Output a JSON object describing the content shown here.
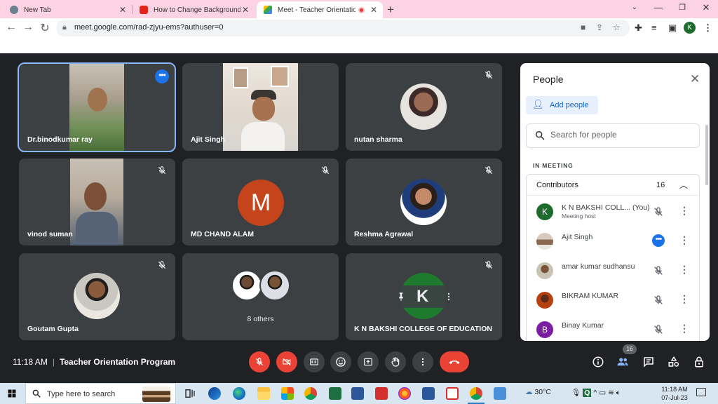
{
  "browser": {
    "tabs": [
      {
        "title": "New Tab",
        "favicon": "globe-icon",
        "active": false
      },
      {
        "title": "How to Change Background in G",
        "favicon": "youtube-icon",
        "active": false
      },
      {
        "title": "Meet - Teacher Orientation P",
        "favicon": "google-meet-icon",
        "active": true
      }
    ],
    "url": "meet.google.com/rad-zjyu-ems?authuser=0",
    "profile_initial": "K",
    "colors": {
      "tabbar": "#fbd3e3",
      "accent": "#1a73e8",
      "end_call": "#ea4335"
    }
  },
  "meet": {
    "tiles": [
      {
        "name": "Dr.binodkumar ray",
        "kind": "video",
        "muted": false,
        "speaking": true
      },
      {
        "name": "Ajit Singh",
        "kind": "video",
        "muted": false
      },
      {
        "name": "nutan sharma",
        "kind": "photo",
        "muted": true
      },
      {
        "name": "vinod suman",
        "kind": "video",
        "muted": true
      },
      {
        "name": "MD CHAND ALAM",
        "kind": "letter",
        "letter": "M",
        "muted": true
      },
      {
        "name": "Reshma Agrawal",
        "kind": "photo",
        "muted": true
      },
      {
        "name": "Goutam Gupta",
        "kind": "photo",
        "muted": true
      },
      {
        "name": "",
        "kind": "others",
        "others_label": "8 others"
      },
      {
        "name": "K N BAKSHI COLLEGE OF EDUCATION",
        "kind": "self",
        "muted": true
      }
    ],
    "time": "11:18 AM",
    "meeting_name": "Teacher Orientation Program",
    "participant_badge": "16"
  },
  "people_panel": {
    "title": "People",
    "add_people": "Add people",
    "search_placeholder": "Search for people",
    "section": "IN MEETING",
    "group": {
      "label": "Contributors",
      "count": "16"
    },
    "participants": [
      {
        "name": "K N BAKSHI COLL...",
        "suffix": "(You)",
        "sub": "Meeting host",
        "initial": "K",
        "avatar_color": "#1e6b2e",
        "muted": true
      },
      {
        "name": "Ajit Singh",
        "sub": "",
        "initial": "",
        "avatar_color": "#b9a99a",
        "speaking": true
      },
      {
        "name": "amar kumar sudhansu",
        "sub": "",
        "initial": "",
        "avatar_color": "#8a6e4f",
        "muted": true
      },
      {
        "name": "BIKRAM KUMAR",
        "sub": "",
        "initial": "",
        "avatar_color": "#b7410e",
        "muted": true
      },
      {
        "name": "Binay Kumar",
        "sub": "",
        "initial": "B",
        "avatar_color": "#7b1fa2",
        "muted": true
      }
    ]
  },
  "taskbar": {
    "search_placeholder": "Type here to search",
    "weather": "30°C",
    "time": "11:18 AM",
    "date": "07-Jul-23"
  }
}
